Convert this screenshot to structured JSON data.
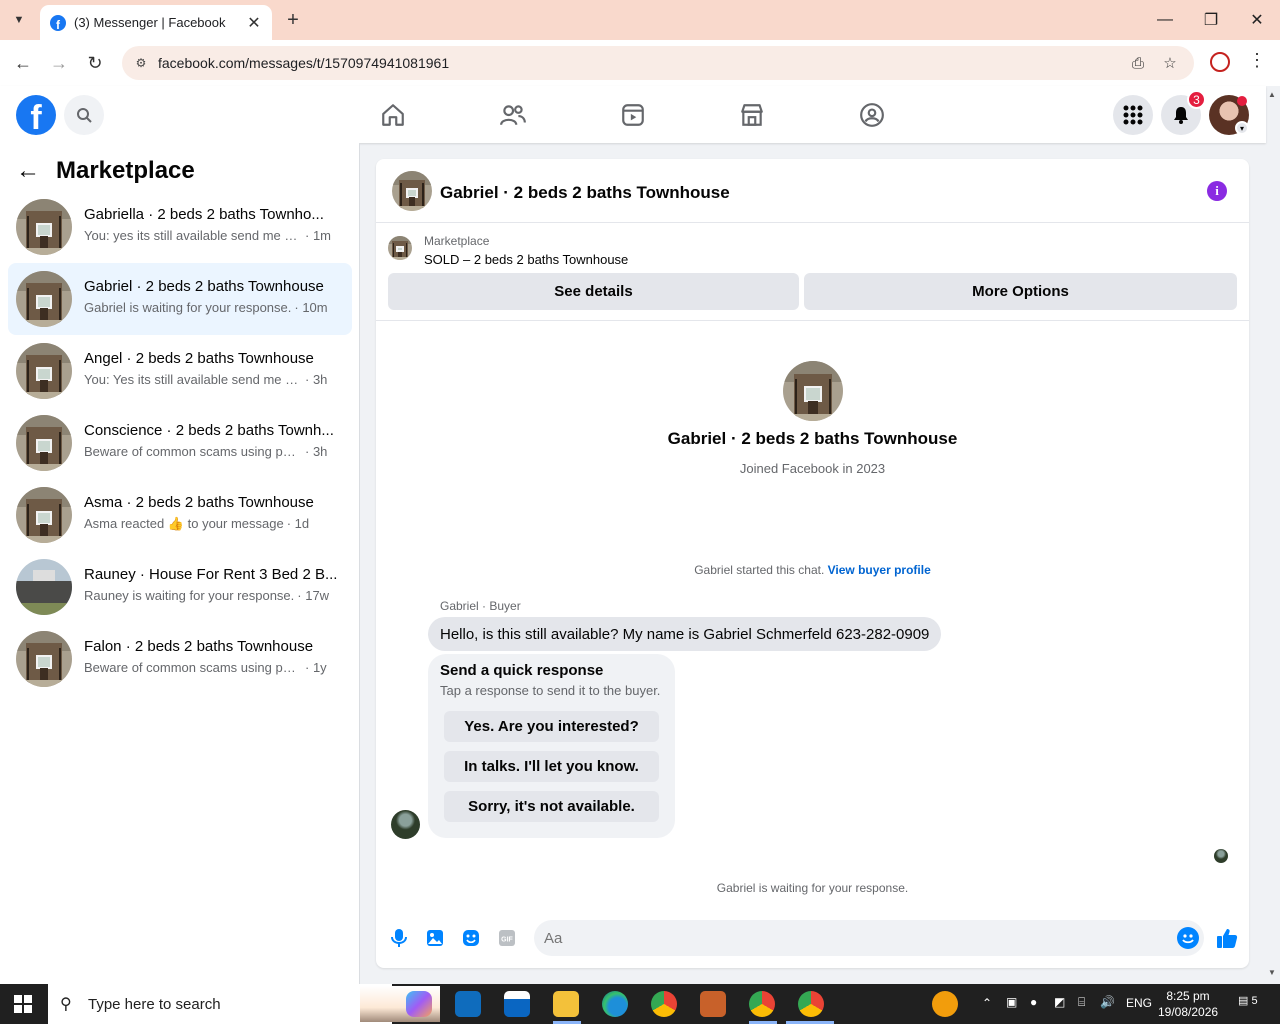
{
  "browser": {
    "tab_title": "(3) Messenger | Facebook",
    "url": "facebook.com/messages/t/1570974941081961"
  },
  "fb_header": {
    "notification_count": "3"
  },
  "sidebar": {
    "title": "Marketplace",
    "conversations": [
      {
        "name": "Gabriella · 2 beds 2 baths Townho...",
        "preview": "You: yes its still available send me yo...",
        "time": "· 1m",
        "active": false
      },
      {
        "name": "Gabriel · 2 beds 2 baths Townhouse",
        "preview": "Gabriel is waiting for your response.",
        "time": "· 10m",
        "active": true
      },
      {
        "name": "Angel · 2 beds 2 baths Townhouse",
        "preview": "You: Yes its still available send me you...",
        "time": "· 3h",
        "active": false
      },
      {
        "name": "Conscience · 2 beds 2 baths Townh...",
        "preview": "Beware of common scams using pay...",
        "time": "· 3h",
        "active": false
      },
      {
        "name": "Asma · 2 beds 2 baths Townhouse",
        "preview": "Asma reacted 👍 to your message",
        "time": "· 1d",
        "active": false
      },
      {
        "name": "Rauney · House For Rent 3 Bed 2 B...",
        "preview": "Rauney is waiting for your response.",
        "time": "· 17w",
        "active": false
      },
      {
        "name": "Falon · 2 beds 2 baths Townhouse",
        "preview": "Beware of common scams using pay...",
        "time": "· 1y",
        "active": false
      }
    ]
  },
  "chat": {
    "header_name": "Gabriel · 2 beds 2 baths Townhouse",
    "listing": {
      "label": "Marketplace",
      "title": "SOLD – 2 beds 2 baths Townhouse",
      "see_details": "See details",
      "more_options": "More Options"
    },
    "profile": {
      "name": "Gabriel · 2 beds 2 baths Townhouse",
      "joined": "Joined Facebook in 2023"
    },
    "started_text": "Gabriel started this chat.",
    "view_buyer_profile": "View buyer profile",
    "sender_label": "Gabriel · Buyer",
    "message": "Hello, is this still available? My name is Gabriel Schmerfeld 623-282-0909",
    "quick_response": {
      "title": "Send a quick response",
      "subtitle": "Tap a response to send it to the buyer.",
      "options": [
        "Yes. Are you interested?",
        "In talks. I'll let you know.",
        "Sorry, it's not available."
      ]
    },
    "waiting_text": "Gabriel is waiting for your response.",
    "composer_placeholder": "Aa"
  },
  "taskbar": {
    "search_placeholder": "Type here to search",
    "language": "ENG",
    "time": "8:25 pm",
    "date": "19/08/2026",
    "notification_count": "5"
  },
  "colors": {
    "facebook_blue": "#1877f2",
    "active_conversation": "#ebf5ff",
    "badge_red": "#e41e3f",
    "info_purple": "#8a2be2"
  }
}
